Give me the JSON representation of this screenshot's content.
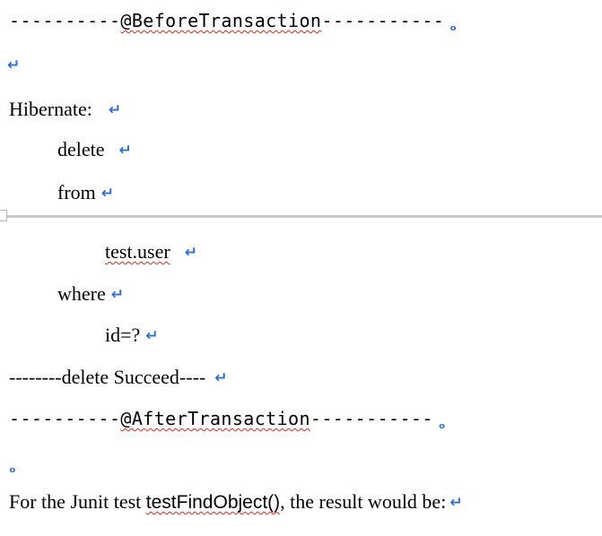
{
  "document": {
    "lines": {
      "before_dashes_left": "----------",
      "before_annotation": "@BeforeTransaction",
      "before_dashes_right": "-----------",
      "hibernate": "Hibernate:",
      "delete_kw": "delete",
      "from_kw": "from",
      "table_name": "test.user",
      "where_kw": "where",
      "condition": "id=?",
      "delete_result": "--------delete Succeed----",
      "after_dashes_left": "----------",
      "after_annotation": "@AfterTransaction",
      "after_dashes_right": "-----------",
      "junit_prefix": "For the Junit test ",
      "junit_method": "testFindObject()",
      "junit_suffix": ", the result would be:"
    },
    "marks": {
      "paragraph": "↵",
      "small": "ₒ"
    },
    "colors": {
      "paragraph_mark": "#2f6fd6",
      "spell_underline": "#e0281e",
      "page_break": "#c9c9c9"
    }
  }
}
